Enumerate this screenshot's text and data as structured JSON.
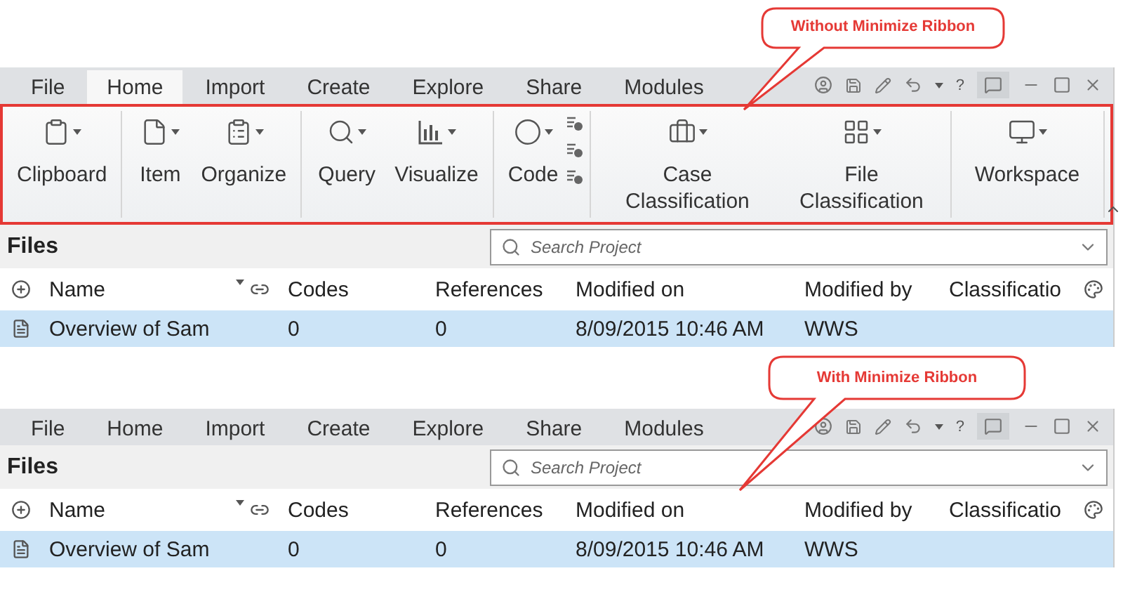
{
  "screens": [
    {
      "callout": "Without Minimize Ribbon",
      "tabs": [
        {
          "label": "File",
          "selected": false
        },
        {
          "label": "Home",
          "selected": true
        },
        {
          "label": "Import",
          "selected": false
        },
        {
          "label": "Create",
          "selected": false
        },
        {
          "label": "Explore",
          "selected": false
        },
        {
          "label": "Share",
          "selected": false
        },
        {
          "label": "Modules",
          "selected": false
        }
      ],
      "help": "?",
      "ribbon": {
        "groups": [
          {
            "buttons": [
              {
                "kind": "clipboard",
                "label": "Clipboard"
              }
            ]
          },
          {
            "buttons": [
              {
                "kind": "item",
                "label": "Item"
              },
              {
                "kind": "organize",
                "label": "Organize"
              }
            ]
          },
          {
            "buttons": [
              {
                "kind": "query",
                "label": "Query"
              },
              {
                "kind": "visualize",
                "label": "Visualize"
              }
            ]
          },
          {
            "buttons": [
              {
                "kind": "code",
                "label": "Code"
              },
              {
                "kind": "stack"
              }
            ]
          },
          {
            "buttons": [
              {
                "kind": "case",
                "label": "Case Classification"
              },
              {
                "kind": "file",
                "label": "File Classification"
              }
            ]
          },
          {
            "buttons": [
              {
                "kind": "workspace",
                "label": "Workspace"
              }
            ]
          }
        ]
      },
      "pane": {
        "title": "Files",
        "search": {
          "placeholder": "Search Project"
        },
        "columns": [
          "Name",
          "Codes",
          "References",
          "Modified on",
          "Modified by",
          "Classificatio"
        ],
        "rows": [
          {
            "selected": true,
            "cells": [
              "Overview of Sam",
              "0",
              "0",
              "8/09/2015 10:46 AM",
              "WWS"
            ]
          }
        ]
      }
    },
    {
      "callout": "With Minimize Ribbon",
      "tabs": [
        {
          "label": "File",
          "selected": false
        },
        {
          "label": "Home",
          "selected": false
        },
        {
          "label": "Import",
          "selected": false
        },
        {
          "label": "Create",
          "selected": false
        },
        {
          "label": "Explore",
          "selected": false
        },
        {
          "label": "Share",
          "selected": false
        },
        {
          "label": "Modules",
          "selected": false
        }
      ],
      "help": "?",
      "pane": {
        "title": "Files",
        "search": {
          "placeholder": "Search Project"
        },
        "columns": [
          "Name",
          "Codes",
          "References",
          "Modified on",
          "Modified by",
          "Classificatio"
        ],
        "rows": [
          {
            "selected": true,
            "cells": [
              "Overview of Sam",
              "0",
              "0",
              "8/09/2015 10:46 AM",
              "WWS"
            ]
          }
        ]
      }
    }
  ]
}
